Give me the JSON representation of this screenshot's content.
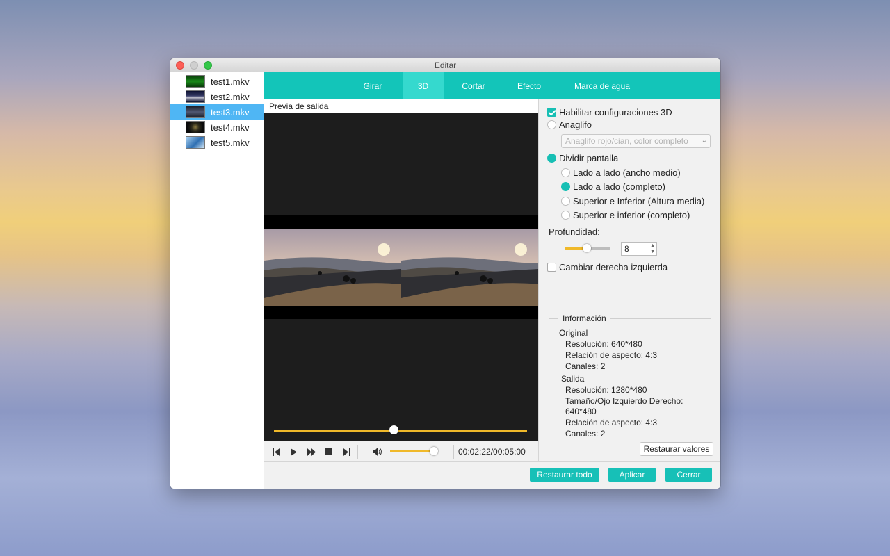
{
  "window": {
    "title": "Editar"
  },
  "files": [
    {
      "name": "test1.mkv",
      "selected": false
    },
    {
      "name": "test2.mkv",
      "selected": false
    },
    {
      "name": "test3.mkv",
      "selected": true
    },
    {
      "name": "test4.mkv",
      "selected": false
    },
    {
      "name": "test5.mkv",
      "selected": false
    }
  ],
  "tabs": [
    {
      "label": "Girar",
      "active": false
    },
    {
      "label": "3D",
      "active": true
    },
    {
      "label": "Cortar",
      "active": false
    },
    {
      "label": "Efecto",
      "active": false
    },
    {
      "label": "Marca de agua",
      "active": false
    }
  ],
  "preview": {
    "label": "Previa de salida",
    "progress": 0.47,
    "volume": 0.88,
    "time": "00:02:22/00:05:00"
  },
  "settings": {
    "enable_3d": {
      "label": "Habilitar configuraciones 3D",
      "checked": true
    },
    "anaglyph": {
      "label": "Anaglifo",
      "checked": false
    },
    "anaglyph_select": "Anaglifo rojo/cian, color completo",
    "split": {
      "label": "Dividir pantalla",
      "checked": true
    },
    "split_options": [
      {
        "label": "Lado a lado (ancho medio)",
        "checked": false
      },
      {
        "label": "Lado a lado (completo)",
        "checked": true
      },
      {
        "label": "Superior e Inferior (Altura media)",
        "checked": false
      },
      {
        "label": "Superior e inferior (completo)",
        "checked": false
      }
    ],
    "depth_label": "Profundidad:",
    "depth_value": "8",
    "depth_fraction": 0.5,
    "swap": {
      "label": "Cambiar derecha izquierda",
      "checked": false
    }
  },
  "info": {
    "heading": "Información",
    "original_label": "Original",
    "original_resolution": "Resolución: 640*480",
    "original_aspect": "Relación de aspecto: 4:3",
    "original_channels": "Canales: 2",
    "output_label": "Salida",
    "output_resolution": "Resolución: 1280*480",
    "output_eye_size_1": "Tamaño/Ojo Izquierdo Derecho:",
    "output_eye_size_2": "640*480",
    "output_aspect": "Relación de aspecto: 4:3",
    "output_channels": "Canales: 2",
    "restore_values": "Restaurar valores"
  },
  "footer": {
    "restore_all": "Restaurar todo",
    "apply": "Aplicar",
    "close": "Cerrar"
  },
  "colors": {
    "accent": "#13c5b9",
    "selection": "#4fb6f4",
    "slider": "#f0b92a"
  }
}
